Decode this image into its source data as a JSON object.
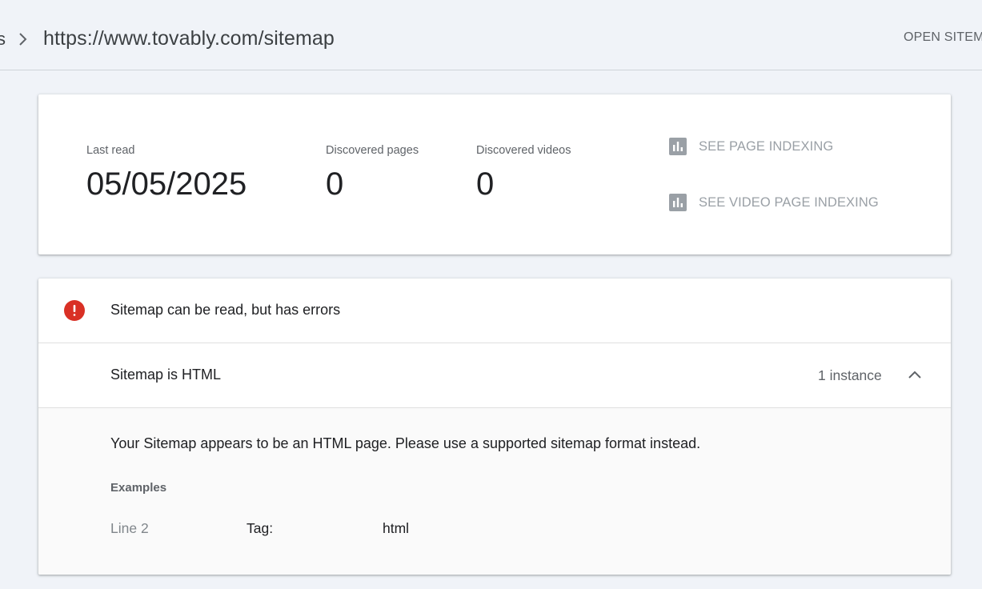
{
  "header": {
    "prev_crumb": "s",
    "title": "https://www.tovably.com/sitemap",
    "open_sitemap_label": "OPEN SITEM"
  },
  "stats": {
    "last_read_label": "Last read",
    "last_read_value": "05/05/2025",
    "pages_label": "Discovered pages",
    "pages_value": "0",
    "videos_label": "Discovered videos",
    "videos_value": "0",
    "page_indexing_label": "SEE PAGE INDEXING",
    "video_indexing_label": "SEE VIDEO PAGE INDEXING"
  },
  "errors": {
    "status_text": "Sitemap can be read, but has errors",
    "issue_title": "Sitemap is HTML",
    "issue_count": "1 instance",
    "description": "Your Sitemap appears to be an HTML page. Please use a supported sitemap format instead.",
    "examples_label": "Examples",
    "example": {
      "line": "Line 2",
      "tag_label": "Tag:",
      "tag_value": "html"
    }
  },
  "colors": {
    "background": "#f0f3f8",
    "error_red": "#d93025",
    "muted_icon": "#9aa0a6"
  },
  "icons": {
    "error": "error-circle-icon",
    "chart": "bar-chart-icon",
    "chevron_up": "chevron-up-icon",
    "chevron_right": "chevron-right-icon"
  }
}
